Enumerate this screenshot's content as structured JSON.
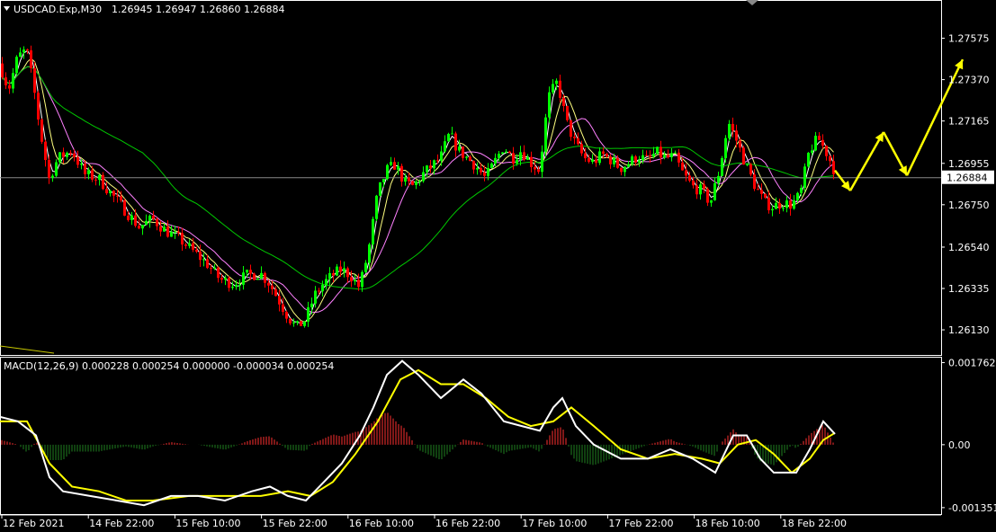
{
  "window": {
    "symbol": "USDCAD.Exp,M30",
    "ohlc": "1.26945 1.26947 1.26860 1.26884",
    "menu_icon": "triangle-down-icon"
  },
  "colors": {
    "background": "#000000",
    "grid_axis": "#ffffff",
    "bull": "#00ff00",
    "bear": "#ff0000",
    "ma_fast": "#ffffff",
    "ma_mid": "#ffff80",
    "ma_slow": "#ff80ff",
    "ma_long": "#00c800",
    "macd_line": "#ffffff",
    "signal_line": "#ffff00",
    "hist_up": "#ff3030",
    "hist_down": "#208020",
    "forecast": "#ffff00",
    "price_box_bg": "#ffffff",
    "price_box_fg": "#000000"
  },
  "chart_data": [
    {
      "type": "candlestick",
      "title": "USDCAD.Exp,M30",
      "y_ticks": [
        "1.27575",
        "1.27370",
        "1.27165",
        "1.26955",
        "1.26750",
        "1.26540",
        "1.26335",
        "1.26130"
      ],
      "ylim": [
        1.2605,
        1.2772
      ],
      "current_price": "1.26884",
      "x_labels": [
        "12 Feb 2021",
        "14 Feb 22:00",
        "15 Feb 10:00",
        "15 Feb 22:00",
        "16 Feb 10:00",
        "16 Feb 22:00",
        "17 Feb 10:00",
        "17 Feb 22:00",
        "18 Feb 10:00",
        "18 Feb 22:00"
      ],
      "price_path": [
        [
          0,
          1.2745
        ],
        [
          10,
          1.2732
        ],
        [
          20,
          1.2748
        ],
        [
          30,
          1.2752
        ],
        [
          38,
          1.2733
        ],
        [
          45,
          1.2712
        ],
        [
          55,
          1.2688
        ],
        [
          65,
          1.2698
        ],
        [
          80,
          1.2702
        ],
        [
          95,
          1.269
        ],
        [
          110,
          1.2688
        ],
        [
          125,
          1.268
        ],
        [
          140,
          1.2672
        ],
        [
          155,
          1.2664
        ],
        [
          170,
          1.2668
        ],
        [
          185,
          1.2662
        ],
        [
          200,
          1.2658
        ],
        [
          215,
          1.2652
        ],
        [
          230,
          1.2646
        ],
        [
          245,
          1.2638
        ],
        [
          260,
          1.2636
        ],
        [
          275,
          1.264
        ],
        [
          290,
          1.2641
        ],
        [
          300,
          1.2636
        ],
        [
          310,
          1.2628
        ],
        [
          320,
          1.262
        ],
        [
          330,
          1.2614
        ],
        [
          340,
          1.2618
        ],
        [
          350,
          1.263
        ],
        [
          360,
          1.2636
        ],
        [
          370,
          1.264
        ],
        [
          380,
          1.2643
        ],
        [
          390,
          1.264
        ],
        [
          400,
          1.2634
        ],
        [
          410,
          1.2652
        ],
        [
          420,
          1.268
        ],
        [
          430,
          1.2692
        ],
        [
          440,
          1.2695
        ],
        [
          450,
          1.2686
        ],
        [
          460,
          1.2684
        ],
        [
          470,
          1.269
        ],
        [
          480,
          1.2694
        ],
        [
          490,
          1.2698
        ],
        [
          500,
          1.271
        ],
        [
          510,
          1.2702
        ],
        [
          520,
          1.2698
        ],
        [
          530,
          1.2694
        ],
        [
          540,
          1.2688
        ],
        [
          550,
          1.2696
        ],
        [
          560,
          1.2704
        ],
        [
          570,
          1.2698
        ],
        [
          580,
          1.2702
        ],
        [
          590,
          1.2696
        ],
        [
          600,
          1.2692
        ],
        [
          610,
          1.2728
        ],
        [
          620,
          1.2736
        ],
        [
          630,
          1.2716
        ],
        [
          640,
          1.2705
        ],
        [
          650,
          1.2698
        ],
        [
          660,
          1.2696
        ],
        [
          670,
          1.27
        ],
        [
          680,
          1.2697
        ],
        [
          690,
          1.2693
        ],
        [
          700,
          1.2696
        ],
        [
          710,
          1.2699
        ],
        [
          720,
          1.2697
        ],
        [
          730,
          1.2701
        ],
        [
          740,
          1.2698
        ],
        [
          750,
          1.2699
        ],
        [
          760,
          1.269
        ],
        [
          770,
          1.2684
        ],
        [
          780,
          1.2682
        ],
        [
          790,
          1.2676
        ],
        [
          800,
          1.2692
        ],
        [
          810,
          1.2716
        ],
        [
          820,
          1.2706
        ],
        [
          830,
          1.2694
        ],
        [
          840,
          1.2684
        ],
        [
          850,
          1.2676
        ],
        [
          860,
          1.2674
        ],
        [
          870,
          1.2676
        ],
        [
          880,
          1.2675
        ],
        [
          890,
          1.268
        ],
        [
          900,
          1.2702
        ],
        [
          910,
          1.2708
        ],
        [
          920,
          1.27
        ],
        [
          928,
          1.2692
        ]
      ],
      "forecast_path": [
        [
          928,
          1.2692
        ],
        [
          945,
          1.2682
        ],
        [
          982,
          1.2711
        ],
        [
          1008,
          1.26895
        ],
        [
          1070,
          1.2747
        ]
      ]
    },
    {
      "type": "line",
      "title": "MACD(12,26,9) 0.000228 0.000254 0.000000 -0.000034 0.000254",
      "y_ticks": [
        "0.001762",
        "0.00",
        "-0.001351"
      ],
      "ylim": [
        -0.00145,
        0.00183
      ],
      "series": [
        {
          "name": "MACD",
          "values": [
            [
              0,
              0.0006
            ],
            [
              20,
              0.0005
            ],
            [
              40,
              0.0002
            ],
            [
              55,
              -0.0007
            ],
            [
              70,
              -0.001
            ],
            [
              100,
              -0.0011
            ],
            [
              130,
              -0.0012
            ],
            [
              160,
              -0.0013
            ],
            [
              190,
              -0.0011
            ],
            [
              220,
              -0.0011
            ],
            [
              250,
              -0.0012
            ],
            [
              280,
              -0.001
            ],
            [
              300,
              -0.0009
            ],
            [
              320,
              -0.0011
            ],
            [
              340,
              -0.0012
            ],
            [
              360,
              -0.0008
            ],
            [
              380,
              -0.0004
            ],
            [
              400,
              0.0002
            ],
            [
              415,
              0.0008
            ],
            [
              430,
              0.0015
            ],
            [
              447,
              0.0018
            ],
            [
              465,
              0.0015
            ],
            [
              490,
              0.001
            ],
            [
              515,
              0.0014
            ],
            [
              535,
              0.0011
            ],
            [
              560,
              0.0005
            ],
            [
              580,
              0.0004
            ],
            [
              600,
              0.0003
            ],
            [
              615,
              0.0008
            ],
            [
              625,
              0.001
            ],
            [
              640,
              0.0004
            ],
            [
              660,
              0.0
            ],
            [
              690,
              -0.0003
            ],
            [
              720,
              -0.0003
            ],
            [
              745,
              -0.0001
            ],
            [
              770,
              -0.0003
            ],
            [
              795,
              -0.0006
            ],
            [
              815,
              0.0002
            ],
            [
              830,
              0.0002
            ],
            [
              845,
              -0.0003
            ],
            [
              860,
              -0.0006
            ],
            [
              885,
              -0.0006
            ],
            [
              900,
              -0.0001
            ],
            [
              915,
              0.0005
            ],
            [
              928,
              0.00023
            ]
          ]
        },
        {
          "name": "Signal",
          "values": [
            [
              0,
              0.0005
            ],
            [
              30,
              0.0005
            ],
            [
              55,
              -0.0004
            ],
            [
              80,
              -0.0009
            ],
            [
              110,
              -0.001
            ],
            [
              140,
              -0.0012
            ],
            [
              170,
              -0.0012
            ],
            [
              210,
              -0.0011
            ],
            [
              250,
              -0.0011
            ],
            [
              290,
              -0.0011
            ],
            [
              320,
              -0.001
            ],
            [
              345,
              -0.0011
            ],
            [
              370,
              -0.0008
            ],
            [
              395,
              -0.0002
            ],
            [
              420,
              0.0005
            ],
            [
              445,
              0.0014
            ],
            [
              465,
              0.0016
            ],
            [
              490,
              0.0013
            ],
            [
              515,
              0.0013
            ],
            [
              540,
              0.001
            ],
            [
              565,
              0.0006
            ],
            [
              590,
              0.0004
            ],
            [
              615,
              0.0005
            ],
            [
              635,
              0.0008
            ],
            [
              660,
              0.0004
            ],
            [
              690,
              -0.0001
            ],
            [
              720,
              -0.0003
            ],
            [
              750,
              -0.0002
            ],
            [
              780,
              -0.0003
            ],
            [
              800,
              -0.0004
            ],
            [
              820,
              0.0
            ],
            [
              840,
              0.0001
            ],
            [
              860,
              -0.0002
            ],
            [
              880,
              -0.0006
            ],
            [
              900,
              -0.0003
            ],
            [
              915,
              0.0001
            ],
            [
              928,
              0.000254
            ]
          ]
        }
      ]
    }
  ]
}
